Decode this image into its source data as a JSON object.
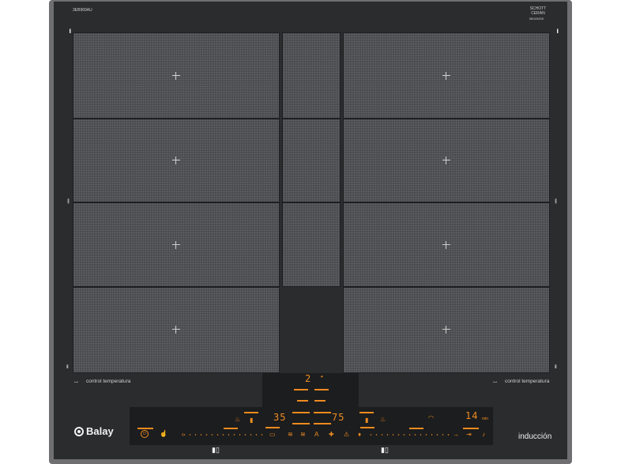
{
  "model_code": "3EB969AU",
  "schott_logo": "SCHOTT CERAN",
  "schott_sub": "8811810D8",
  "brand": "Balay",
  "product_label": "inducción",
  "left_temp_label": "control temperatura",
  "right_temp_label": "control temperatura",
  "center_display": "2",
  "left_display": "35",
  "mid_display": "75",
  "timer_display": "14",
  "timer_unit": "min",
  "power_icon": "power-icon",
  "small_mark_top": "1",
  "colors": {
    "accent": "#f08c22",
    "glass": "#2b2c2d",
    "frame": "#6f6f71"
  }
}
